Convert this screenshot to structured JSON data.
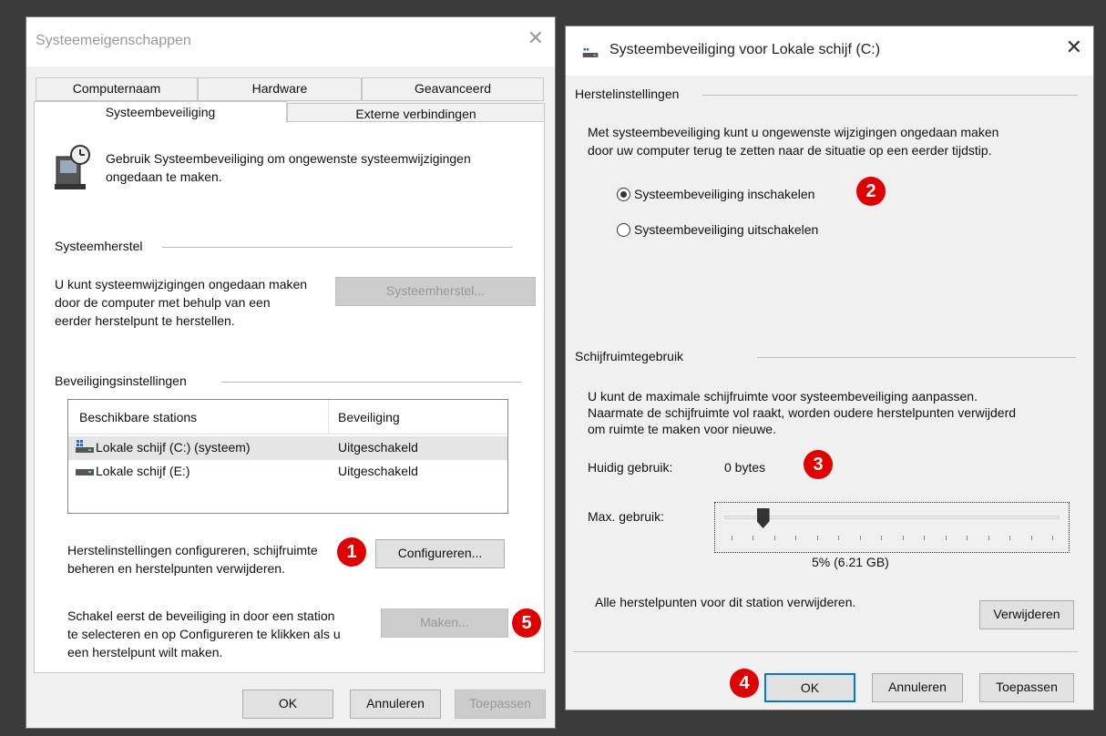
{
  "left_dialog": {
    "title": "Systeemeigenschappen",
    "tabs": [
      "Computernaam",
      "Hardware",
      "Geavanceerd",
      "Systeembeveiliging",
      "Externe verbindingen"
    ],
    "intro_line1": "Gebruik Systeembeveiliging om ongewenste systeemwijzigingen",
    "intro_line2": "ongedaan te maken.",
    "restore_group": "Systeemherstel",
    "restore_text1": "U kunt systeemwijzigingen ongedaan maken",
    "restore_text2": "door de computer met behulp van een",
    "restore_text3": "eerder herstelpunt te herstellen.",
    "restore_button": "Systeemherstel...",
    "protection_group": "Beveiligingsinstellingen",
    "col_drives": "Beschikbare stations",
    "col_protection": "Beveiliging",
    "drives": [
      {
        "name": "Lokale schijf (C:) (systeem)",
        "status": "Uitgeschakeld"
      },
      {
        "name": "Lokale schijf (E:)",
        "status": "Uitgeschakeld"
      }
    ],
    "configure_text1": "Herstelinstellingen configureren, schijfruimte",
    "configure_text2": "beheren en herstelpunten verwijderen.",
    "configure_button": "Configureren...",
    "create_text1": "Schakel eerst de beveiliging in door een station",
    "create_text2": "te selecteren en op Configureren te klikken als u",
    "create_text3": "een herstelpunt wilt maken.",
    "create_button": "Maken...",
    "ok": "OK",
    "cancel": "Annuleren",
    "apply": "Toepassen"
  },
  "right_dialog": {
    "title": "Systeembeveiliging voor Lokale schijf (C:)",
    "restore_group": "Herstelinstellingen",
    "restore_desc1": "Met systeembeveiliging kunt u ongewenste wijzigingen ongedaan maken",
    "restore_desc2": "door uw computer terug te zetten naar de situatie op een eerder tijdstip.",
    "radio_on": "Systeembeveiliging inschakelen",
    "radio_off": "Systeembeveiliging uitschakelen",
    "disk_group": "Schijfruimtegebruik",
    "disk_desc1": "U kunt de maximale schijfruimte voor systeembeveiliging aanpassen.",
    "disk_desc2": "Naarmate de schijfruimte vol raakt, worden oudere herstelpunten verwijderd",
    "disk_desc3": "om ruimte te maken voor nieuwe.",
    "current_label": "Huidig gebruik:",
    "current_value": "0 bytes",
    "max_label": "Max. gebruik:",
    "max_value": "5% (6.21 GB)",
    "max_percent": 5,
    "delete_text": "Alle herstelpunten voor dit station verwijderen.",
    "delete_button": "Verwijderen",
    "ok": "OK",
    "cancel": "Annuleren",
    "apply": "Toepassen"
  },
  "badges": [
    "1",
    "2",
    "3",
    "4",
    "5"
  ],
  "colors": {
    "badge": "#e00000",
    "dialog_bg": "#f0f0f0",
    "backdrop": "#3b3b3b"
  }
}
